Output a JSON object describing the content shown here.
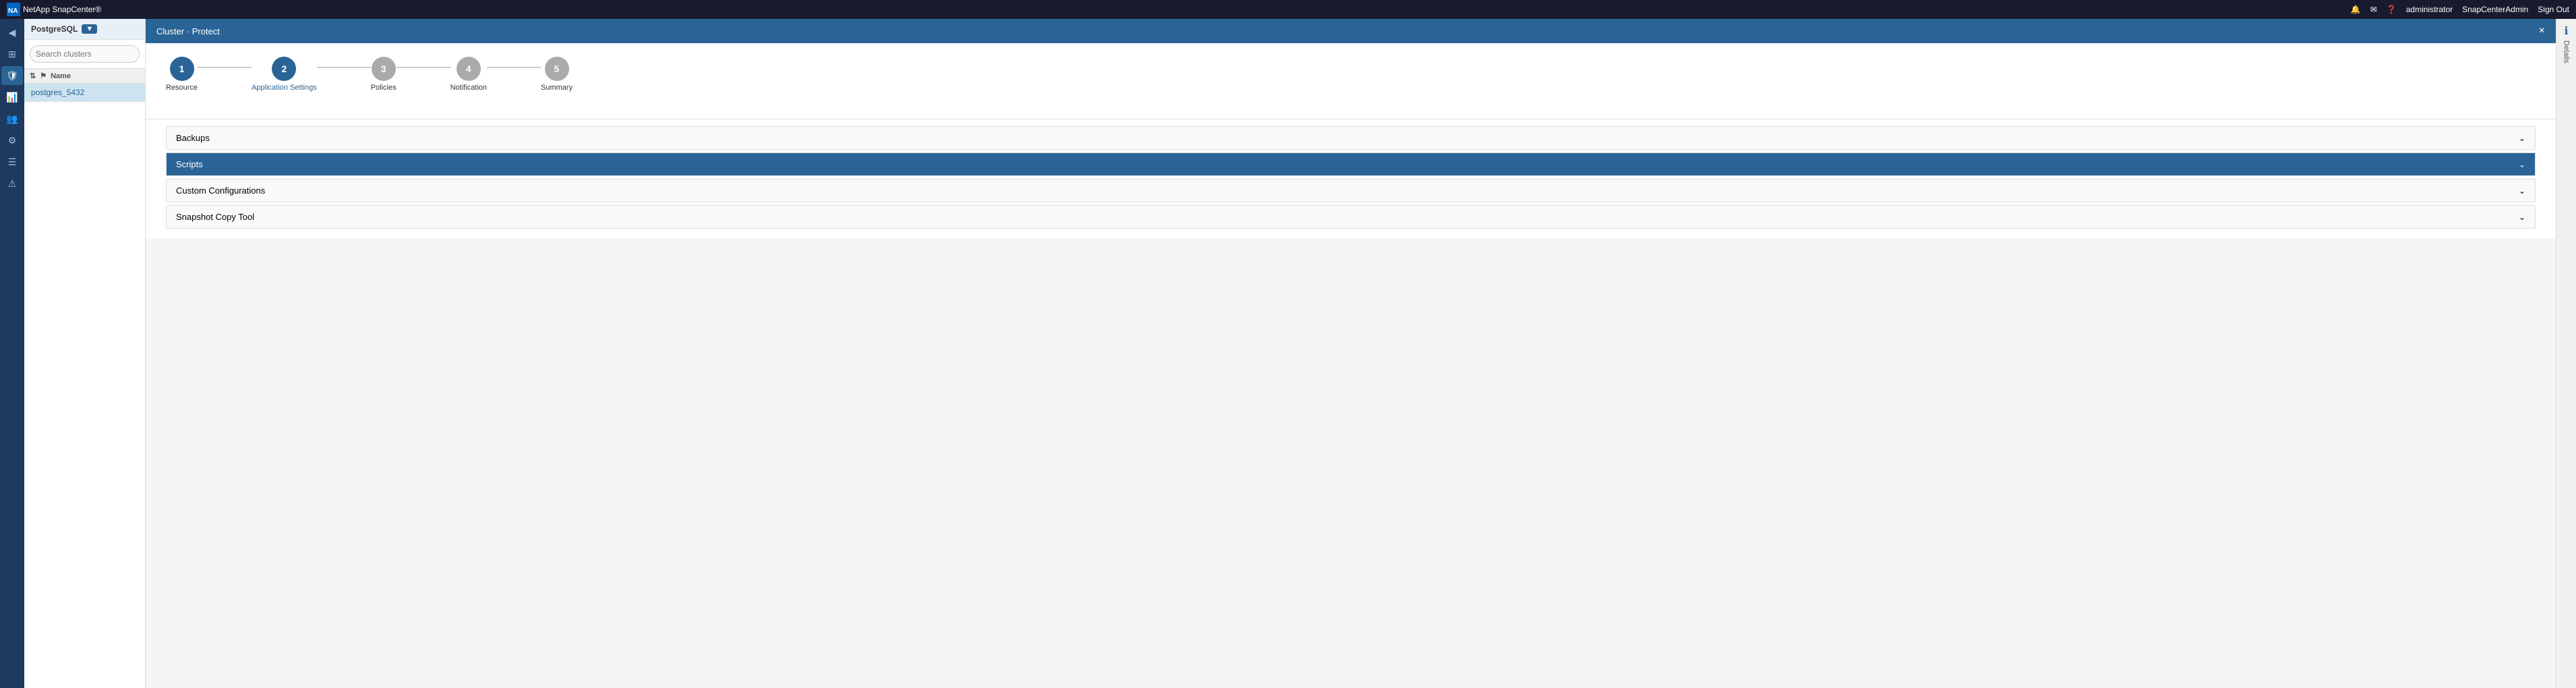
{
  "topBar": {
    "logo": "NetApp SnapCenter®",
    "icons": {
      "bell": "🔔",
      "mail": "✉",
      "help": "❓"
    },
    "user": "administrator",
    "instance": "SnapCenterAdmin",
    "signOut": "Sign Out"
  },
  "sidebar": {
    "dbType": "PostgreSQL",
    "searchPlaceholder": "Search clusters",
    "tableHeader": "Name",
    "items": [
      {
        "label": "postgres_5432"
      }
    ]
  },
  "contentHeader": {
    "breadcrumb": "Cluster · Protect",
    "closeLabel": "×"
  },
  "wizard": {
    "steps": [
      {
        "number": "1",
        "label": "Resource",
        "state": "completed"
      },
      {
        "number": "2",
        "label": "Application Settings",
        "state": "active"
      },
      {
        "number": "3",
        "label": "Policies",
        "state": "default"
      },
      {
        "number": "4",
        "label": "Notification",
        "state": "default"
      },
      {
        "number": "5",
        "label": "Summary",
        "state": "default"
      }
    ]
  },
  "accordion": {
    "sections": [
      {
        "label": "Backups",
        "expanded": false
      },
      {
        "label": "Scripts",
        "expanded": true
      },
      {
        "label": "Custom Configurations",
        "expanded": false
      },
      {
        "label": "Snapshot Copy Tool",
        "expanded": false
      }
    ]
  },
  "detailsPanel": {
    "icon": "ℹ",
    "label": "Details"
  },
  "iconRail": {
    "items": [
      {
        "icon": "◀",
        "name": "collapse-icon",
        "active": false
      },
      {
        "icon": "⊞",
        "name": "grid-icon",
        "active": false
      },
      {
        "icon": "🛡",
        "name": "protect-icon",
        "active": true
      },
      {
        "icon": "📊",
        "name": "reports-icon",
        "active": false
      },
      {
        "icon": "👥",
        "name": "users-icon",
        "active": false
      },
      {
        "icon": "⚙",
        "name": "settings-icon",
        "active": false
      },
      {
        "icon": "☰",
        "name": "menu-icon",
        "active": false
      },
      {
        "icon": "⚠",
        "name": "alerts-icon",
        "active": false
      }
    ]
  }
}
